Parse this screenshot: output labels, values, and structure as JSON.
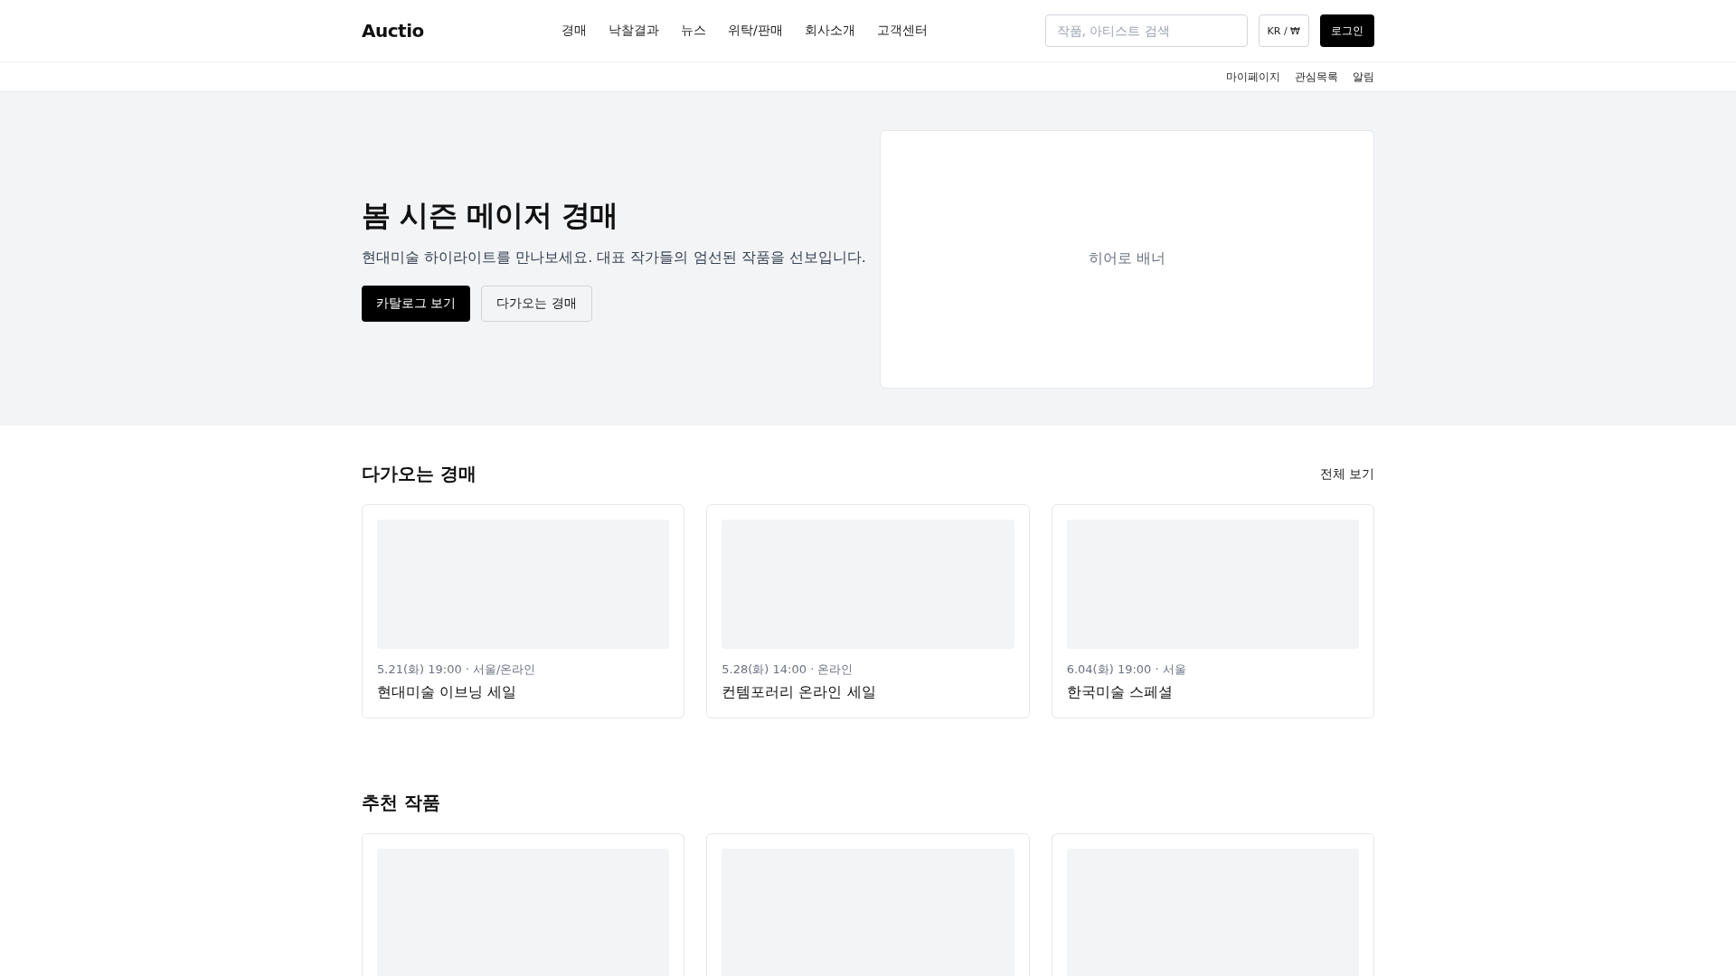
{
  "header": {
    "logo": "Auctio",
    "nav": [
      {
        "label": "경매"
      },
      {
        "label": "낙찰결과"
      },
      {
        "label": "뉴스"
      },
      {
        "label": "위탁/판매"
      },
      {
        "label": "회사소개"
      },
      {
        "label": "고객센터"
      }
    ],
    "search": {
      "placeholder": "작품, 아티스트 검색"
    },
    "currency_button": "KR / ₩",
    "login_button": "로그인"
  },
  "sub_nav": [
    "마이페이지",
    "관심목록",
    "알림"
  ],
  "hero": {
    "title": "봄 시즌 메이저 경매",
    "subtitle": "현대미술 하이라이트를 만나보세요. 대표 작가들의 엄선된 작품을 선보입니다.",
    "buttons": [
      {
        "label": "카탈로그 보기",
        "kind": "primary"
      },
      {
        "label": "다가오는 경매",
        "kind": "secondary"
      }
    ],
    "banner": "히어로 배너"
  },
  "upcoming": {
    "title": "다가오는 경매",
    "view_all": "전체 보기",
    "cards": [
      {
        "kind": "auction",
        "meta": "5.21(화) 19:00 · 서울/온라인",
        "title": "현대미술 이브닝 세일"
      },
      {
        "kind": "auction",
        "meta": "5.28(화) 14:00 · 온라인",
        "title": "컨템포러리 온라인 세일"
      },
      {
        "kind": "auction",
        "meta": "6.04(화) 19:00 · 서울",
        "title": "한국미술 스페셜"
      }
    ]
  },
  "recommended": {
    "title": "추천 작품",
    "cards": [
      {
        "kind": "placeholder"
      },
      {
        "kind": "placeholder"
      },
      {
        "kind": "placeholder"
      }
    ]
  }
}
